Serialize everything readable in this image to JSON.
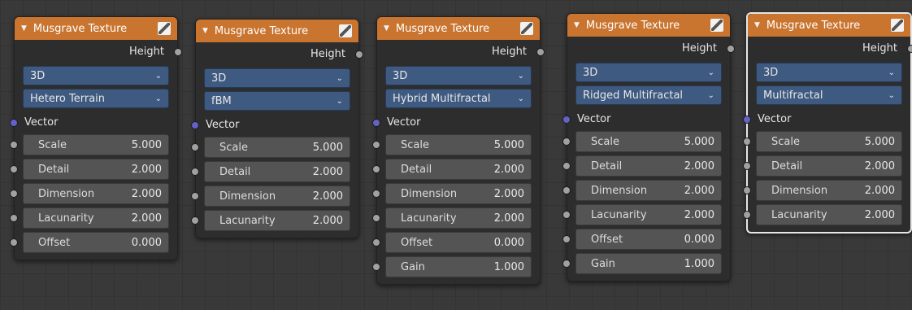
{
  "nodes": [
    {
      "title": "Musgrave Texture",
      "output": "Height",
      "dimension": "3D",
      "type": "Hetero Terrain",
      "vector_label": "Vector",
      "fields": [
        {
          "label": "Scale",
          "value": "5.000"
        },
        {
          "label": "Detail",
          "value": "2.000"
        },
        {
          "label": "Dimension",
          "value": "2.000"
        },
        {
          "label": "Lacunarity",
          "value": "2.000"
        },
        {
          "label": "Offset",
          "value": "0.000"
        }
      ]
    },
    {
      "title": "Musgrave Texture",
      "output": "Height",
      "dimension": "3D",
      "type": "fBM",
      "vector_label": "Vector",
      "fields": [
        {
          "label": "Scale",
          "value": "5.000"
        },
        {
          "label": "Detail",
          "value": "2.000"
        },
        {
          "label": "Dimension",
          "value": "2.000"
        },
        {
          "label": "Lacunarity",
          "value": "2.000"
        }
      ]
    },
    {
      "title": "Musgrave Texture",
      "output": "Height",
      "dimension": "3D",
      "type": "Hybrid Multifractal",
      "vector_label": "Vector",
      "fields": [
        {
          "label": "Scale",
          "value": "5.000"
        },
        {
          "label": "Detail",
          "value": "2.000"
        },
        {
          "label": "Dimension",
          "value": "2.000"
        },
        {
          "label": "Lacunarity",
          "value": "2.000"
        },
        {
          "label": "Offset",
          "value": "0.000"
        },
        {
          "label": "Gain",
          "value": "1.000"
        }
      ]
    },
    {
      "title": "Musgrave Texture",
      "output": "Height",
      "dimension": "3D",
      "type": "Ridged Multifractal",
      "vector_label": "Vector",
      "fields": [
        {
          "label": "Scale",
          "value": "5.000"
        },
        {
          "label": "Detail",
          "value": "2.000"
        },
        {
          "label": "Dimension",
          "value": "2.000"
        },
        {
          "label": "Lacunarity",
          "value": "2.000"
        },
        {
          "label": "Offset",
          "value": "0.000"
        },
        {
          "label": "Gain",
          "value": "1.000"
        }
      ]
    },
    {
      "title": "Musgrave Texture",
      "output": "Height",
      "dimension": "3D",
      "type": "Multifractal",
      "vector_label": "Vector",
      "fields": [
        {
          "label": "Scale",
          "value": "5.000"
        },
        {
          "label": "Detail",
          "value": "2.000"
        },
        {
          "label": "Dimension",
          "value": "2.000"
        },
        {
          "label": "Lacunarity",
          "value": "2.000"
        }
      ]
    }
  ]
}
